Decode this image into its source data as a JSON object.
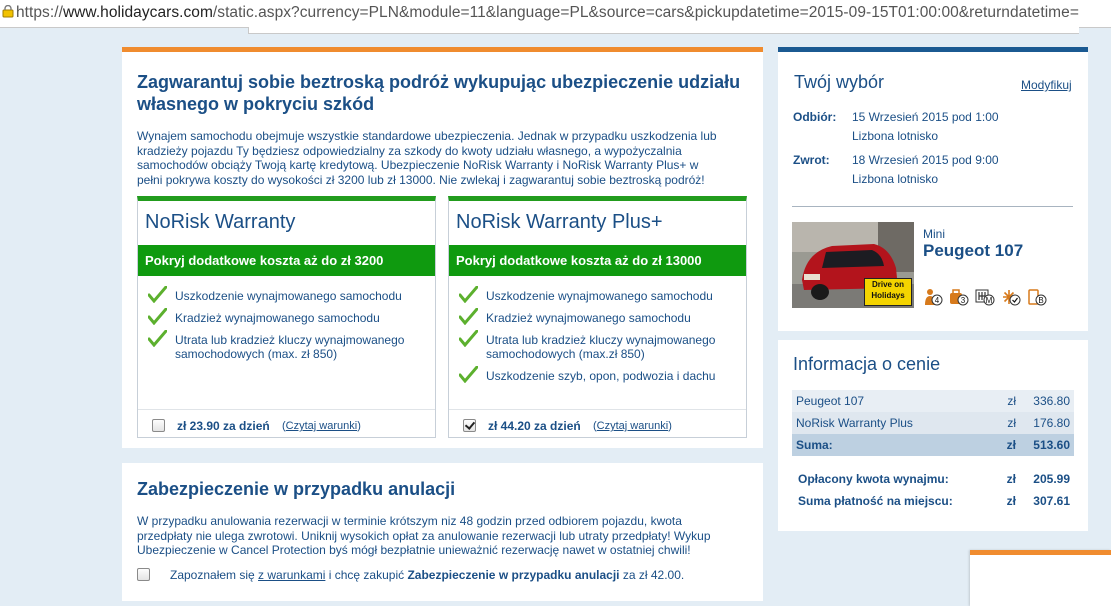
{
  "browser": {
    "url_prefix": "https://",
    "url_host": "www.holidaycars.com",
    "url_rest": "/static.aspx?currency=PLN&module=11&language=PL&source=cars&pickupdatetime=2015-09-15T01:00:00&returndatetime="
  },
  "insurance": {
    "heading": "Zagwarantuj sobie beztroską podróż wykupując ubezpieczenie udziału własnego w pokryciu szkód",
    "intro": "Wynajem samochodu obejmuje wszystkie standardowe ubezpieczenia. Jednak w przypadku uszkodzenia lub kradzieży pojazdu Ty będziesz odpowiedzialny za szkody do kwoty udziału własnego, a wypożyczalnia samochodów obciąży Twoją kartę kredytową. Ubezpieczenie NoRisk Warranty i NoRisk Warranty Plus+ w pełni pokrywa koszty do wysokości zł 3200 lub zł 13000. Nie zwlekaj i zagwarantuj sobie beztroską podróż!",
    "options": [
      {
        "title": "NoRisk Warranty",
        "band": "Pokryj dodatkowe koszta aż do zł 3200",
        "features": [
          "Uszkodzenie wynajmowanego samochodu",
          "Kradzież wynajmowanego samochodu",
          "Utrata lub kradzież kluczy wynajmowanego samochodowych (max. zł 850)"
        ],
        "price": "zł 23.90 za dzień",
        "terms": "Czytaj warunki",
        "checked": false
      },
      {
        "title": "NoRisk Warranty Plus+",
        "band": "Pokryj dodatkowe koszta aż do zł 13000",
        "features": [
          "Uszkodzenie wynajmowanego samochodu",
          "Kradzież wynajmowanego samochodu",
          "Utrata lub kradzież kluczy wynajmowanego samochodowych (max.zł 850)",
          "Uszkodzenie szyb, opon, podwozia i dachu"
        ],
        "price": "zł 44.20 za dzień",
        "terms": "Czytaj warunki",
        "checked": true
      }
    ]
  },
  "cancellation": {
    "heading": "Zabezpieczenie w przypadku anulacji",
    "text": "W przypadku anulowania rezerwacji w terminie krótszym niz 48 godzin przed odbiorem pojazdu, kwota przedpłaty nie ulega zwrotowi. Uniknij wysokich opłat za anulowanie rezerwacji lub utraty przedpłaty! Wykup Ubezpieczenie w Cancel Protection byś mógł bezpłatnie unieważnić rezerwację nawet w ostatniej chwili!",
    "check_pre": "Zapoznałem się ",
    "check_link": "z warunkami",
    "check_mid": " i chcę zakupić ",
    "check_bold": "Zabezpieczenie w przypadku anulacji",
    "check_post": " za zł 42.00.",
    "checked": false
  },
  "choice": {
    "heading": "Twój wybór",
    "modify": "Modyfikuj",
    "pickup_label": "Odbiór:",
    "pickup_date": "15 Wrzesień 2015 pod 1:00",
    "pickup_place": "Lizbona lotnisko",
    "return_label": "Zwrot:",
    "return_date": "18 Wrzesień 2015 pod 9:00",
    "return_place": "Lizbona lotnisko",
    "car_category": "Mini",
    "car_name": "Peugeot 107",
    "car_badge_line1": "Drive on",
    "car_badge_line2": "Holidays",
    "feature_icons": [
      {
        "name": "passengers-icon",
        "value": "4"
      },
      {
        "name": "luggage-icon",
        "value": "3"
      },
      {
        "name": "manual-transmission-icon",
        "value": "M"
      },
      {
        "name": "air-conditioning-icon",
        "value": ""
      },
      {
        "name": "fuel-icon",
        "value": "B"
      }
    ]
  },
  "price_info": {
    "heading": "Informacja o cenie",
    "rows": [
      {
        "label": "Peugeot 107",
        "cur": "zł",
        "amount": "336.80"
      },
      {
        "label": "NoRisk Warranty Plus",
        "cur": "zł",
        "amount": "176.80"
      }
    ],
    "sum_label": "Suma:",
    "sum_cur": "zł",
    "sum_amount": "513.60",
    "paid_label": "Opłacony kwota wynajmu:",
    "paid_cur": "zł",
    "paid_amount": "205.99",
    "onsite_label": "Suma płatność na miejscu:",
    "onsite_cur": "zł",
    "onsite_amount": "307.61"
  },
  "colors": {
    "accent_orange": "#f08c2f",
    "accent_blue": "#1b5a92",
    "green": "#0f9a0f",
    "text": "#1b4f86"
  }
}
